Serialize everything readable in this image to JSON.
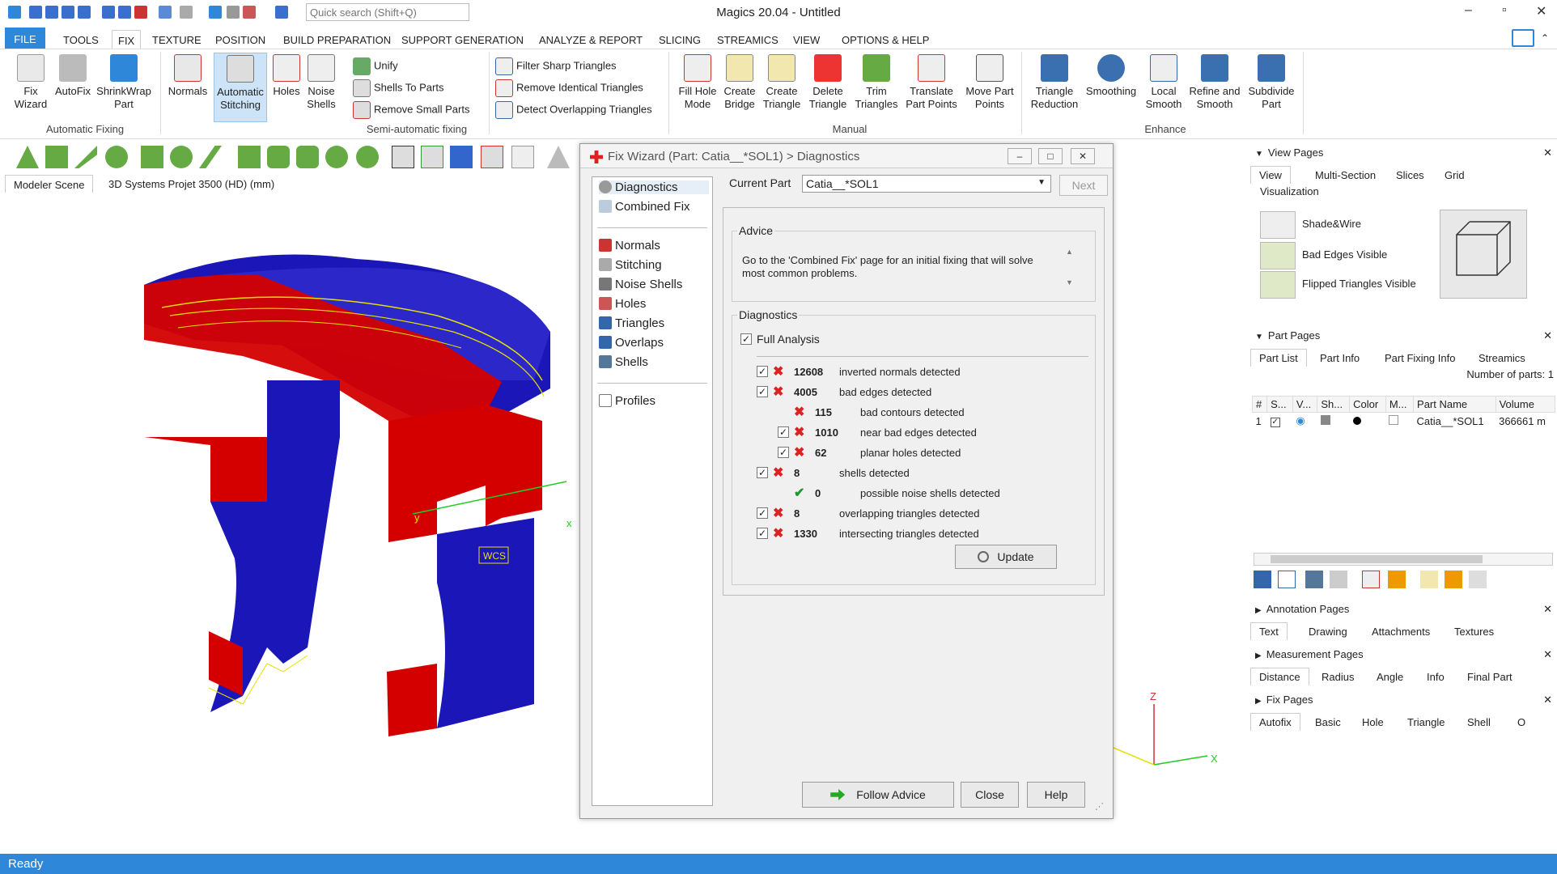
{
  "app": {
    "title": "Magics 20.04 - Untitled",
    "quick_search_placeholder": "Quick search (Shift+Q)"
  },
  "menu": [
    "FILE",
    "TOOLS",
    "FIX",
    "TEXTURE",
    "POSITION",
    "BUILD PREPARATION",
    "SUPPORT GENERATION",
    "ANALYZE & REPORT",
    "SLICING",
    "STREAMICS",
    "VIEW",
    "OPTIONS & HELP"
  ],
  "menu_active": "FIX",
  "ribbon": {
    "automatic_fixing": {
      "label": "Automatic Fixing",
      "buttons": [
        "Fix\nWizard",
        "AutoFix",
        "ShrinkWrap\nPart"
      ]
    },
    "semi_automatic": {
      "label": "Semi-automatic fixing",
      "buttons": [
        "Normals",
        "Automatic\nStitching",
        "Holes",
        "Noise\nShells"
      ],
      "small": [
        "Unify",
        "Shells To Parts",
        "Remove Small Parts"
      ]
    },
    "triangle_tools": [
      "Filter Sharp Triangles",
      "Remove Identical Triangles",
      "Detect Overlapping Triangles"
    ],
    "manual": {
      "label": "Manual",
      "buttons": [
        "Fill Hole\nMode",
        "Create\nBridge",
        "Create\nTriangle",
        "Delete\nTriangle",
        "Trim\nTriangles",
        "Translate\nPart Points",
        "Move Part\nPoints"
      ]
    },
    "enhance": {
      "label": "Enhance",
      "buttons": [
        "Triangle\nReduction",
        "Smoothing",
        "Local\nSmooth",
        "Refine and\nSmooth",
        "Subdivide\nPart"
      ]
    }
  },
  "scene_tabs": [
    "Modeler Scene",
    "3D Systems Projet 3500 (HD) (mm)"
  ],
  "viewport": {
    "wcs_label": "WCS",
    "axis_x": "x",
    "axis_y": "y",
    "axis_z": "Z",
    "axis_x2": "X"
  },
  "dialog": {
    "title": "Fix Wizard (Part: Catia__*SOL1) > Diagnostics",
    "nav_top": [
      "Diagnostics",
      "Combined Fix"
    ],
    "nav_mid": [
      "Normals",
      "Stitching",
      "Noise Shells",
      "Holes",
      "Triangles",
      "Overlaps",
      "Shells"
    ],
    "nav_bottom": [
      "Profiles"
    ],
    "current_part_label": "Current Part",
    "current_part_value": "Catia__*SOL1",
    "next": "Next",
    "advice_legend": "Advice",
    "advice_text": "Go to the 'Combined Fix' page for an initial fixing that will solve most common problems.",
    "diagnostics_legend": "Diagnostics",
    "full_analysis": "Full Analysis",
    "rows": [
      {
        "count": "12608",
        "label": "inverted normals detected",
        "checked": true,
        "status": "bad",
        "indent": 0
      },
      {
        "count": "4005",
        "label": "bad edges detected",
        "checked": true,
        "status": "bad",
        "indent": 0
      },
      {
        "count": "115",
        "label": "bad contours detected",
        "checked": null,
        "status": "bad",
        "indent": 1
      },
      {
        "count": "1010",
        "label": "near bad edges detected",
        "checked": true,
        "status": "bad",
        "indent": 1
      },
      {
        "count": "62",
        "label": "planar holes detected",
        "checked": true,
        "status": "bad",
        "indent": 1
      },
      {
        "count": "8",
        "label": "shells detected",
        "checked": true,
        "status": "bad",
        "indent": 0
      },
      {
        "count": "0",
        "label": "possible noise shells detected",
        "checked": null,
        "status": "ok",
        "indent": 1
      },
      {
        "count": "8",
        "label": "overlapping triangles detected",
        "checked": true,
        "status": "bad",
        "indent": 0
      },
      {
        "count": "1330",
        "label": "intersecting triangles detected",
        "checked": true,
        "status": "bad",
        "indent": 0
      }
    ],
    "update": "Update",
    "follow_advice": "Follow Advice",
    "close": "Close",
    "help": "Help"
  },
  "right": {
    "view_pages": "View Pages",
    "view_tabs": [
      "View",
      "Multi-Section",
      "Slices",
      "Grid"
    ],
    "visualization": "Visualization",
    "vis_items": [
      "Shade&Wire",
      "Bad Edges Visible",
      "Flipped Triangles Visible"
    ],
    "part_pages": "Part Pages",
    "part_tabs": [
      "Part List",
      "Part Info",
      "Part Fixing Info",
      "Streamics"
    ],
    "num_parts": "Number of parts: 1",
    "columns": [
      "#",
      "S...",
      "V...",
      "Sh...",
      "Color",
      "M...",
      "Part Name",
      "Volume"
    ],
    "row": {
      "num": "1",
      "name": "Catia__*SOL1",
      "volume": "366661 m"
    },
    "annotation_pages": "Annotation Pages",
    "annotation_tabs": [
      "Text",
      "Drawing",
      "Attachments",
      "Textures"
    ],
    "measurement_pages": "Measurement Pages",
    "measurement_tabs": [
      "Distance",
      "Radius",
      "Angle",
      "Info",
      "Final Part"
    ],
    "fix_pages": "Fix Pages",
    "fix_tabs": [
      "Autofix",
      "Basic",
      "Hole",
      "Triangle",
      "Shell",
      "O"
    ]
  },
  "status": "Ready",
  "colors": {
    "accent": "#2e87d8",
    "model_red": "#d40000",
    "model_blue": "#1a16b8",
    "wire": "#e6e000"
  }
}
